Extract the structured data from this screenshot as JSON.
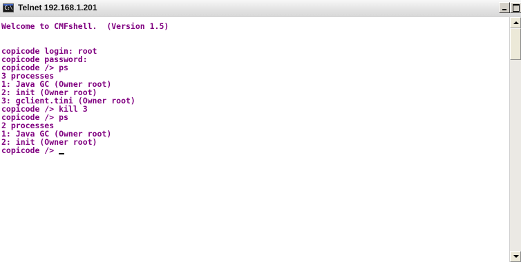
{
  "window": {
    "title": "Telnet 192.168.1.201",
    "icon": "console-icon",
    "icon_glyph": "C:\\",
    "controls": {
      "minimize": "minimize-icon",
      "maximize": "maximize-icon",
      "close_label": "×"
    }
  },
  "console": {
    "text_color": "#800080",
    "background": "#ffffff",
    "lines": [
      "Welcome to CMFshell.  (Version 1.5)",
      "",
      "",
      "copicode login: root",
      "copicode password:",
      "copicode /> ps",
      "3 processes",
      "1: Java GC (Owner root)",
      "2: init (Owner root)",
      "3: gclient.tini (Owner root)",
      "copicode /> kill 3",
      "copicode /> ps",
      "2 processes",
      "1: Java GC (Owner root)",
      "2: init (Owner root)",
      "copicode /> "
    ]
  },
  "scrollbar": {
    "up": "scroll-up-arrow-icon",
    "down": "scroll-down-arrow-icon"
  }
}
